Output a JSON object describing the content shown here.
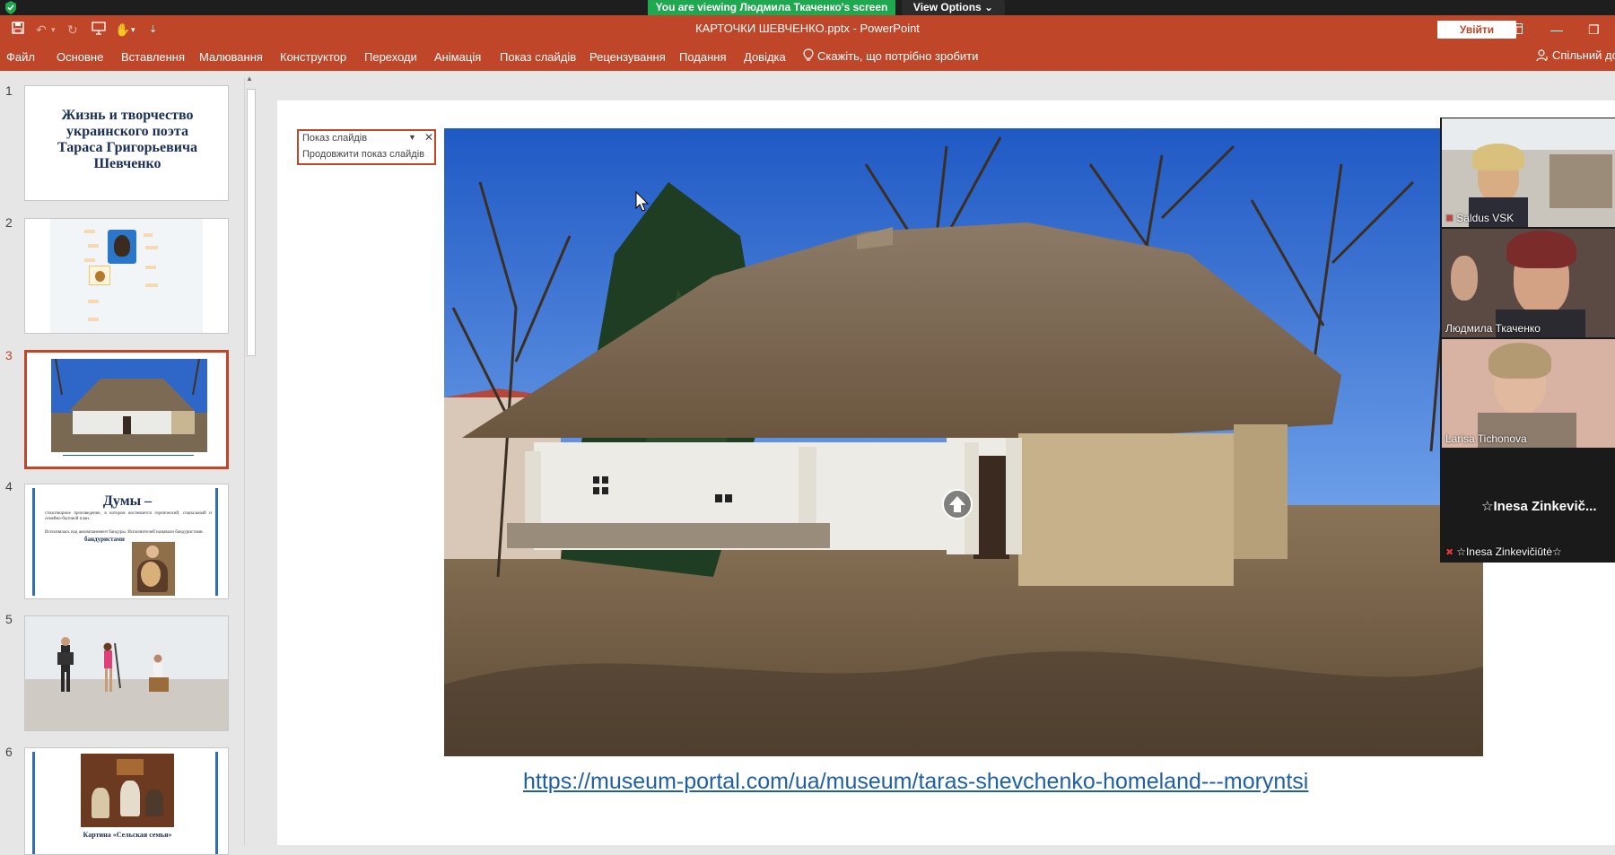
{
  "zoom": {
    "viewing_banner": "You are viewing Людмила Ткаченко's screen",
    "view_options": "View Options ⌄"
  },
  "titlebar": {
    "doc_title": "КАРТОЧКИ ШЕВЧЕНКО.pptx  -  PowerPoint",
    "signin": "Увійти"
  },
  "ribbon": {
    "tabs": [
      "Файл",
      "Основне",
      "Вставлення",
      "Малювання",
      "Конструктор",
      "Переходи",
      "Анімація",
      "Показ слайдів",
      "Рецензування",
      "Подання",
      "Довідка"
    ],
    "tellme": "Скажіть, що потрібно зробити",
    "share": "Спільний до"
  },
  "thumbnails": {
    "numbers": [
      "1",
      "2",
      "3",
      "4",
      "5",
      "6"
    ],
    "slide1_title": "Жизнь и творчество украинского поэта Тараса Григорьевича Шевченко",
    "slide4_title": "Думы –",
    "slide4_text1": "стихотворное произведение, в котором воспевается героический, социальный и семейно-бытовой план.",
    "slide4_text2": "Исполнялась под аккомпанемент бандуры. Исполнителей называли бандуристами.",
    "slide4_emph": "бандуристами",
    "slide6_caption": "Картина «Сельская семья»"
  },
  "popup": {
    "title": "Показ слайдів",
    "action": "Продовжити показ слайдів"
  },
  "slide": {
    "url": "https://museum-portal.com/ua/museum/taras-shevchenko-homeland---moryntsi"
  },
  "participants": [
    {
      "name": "Saldus VSK",
      "muted": true
    },
    {
      "name": "Людмила Ткаченко",
      "muted": false
    },
    {
      "name": "Larisa Tichonova",
      "muted": false
    },
    {
      "name": "☆Inesa Zinkevičiūtė☆",
      "muted": true
    }
  ],
  "participant_big_name": "☆Inesa  Zinkevič...",
  "colors": {
    "accent": "#c0462a",
    "zoom_green": "#1fa84f",
    "link_blue": "#1f5fa8"
  }
}
